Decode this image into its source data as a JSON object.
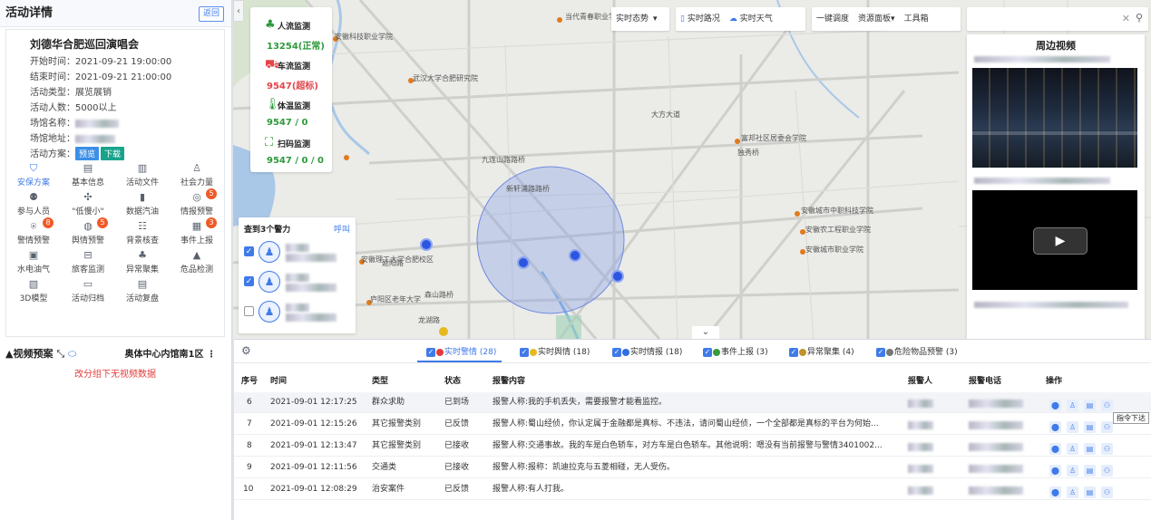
{
  "left_panel": {
    "title": "活动详情",
    "back_label": "返回",
    "event": {
      "name": "刘德华合肥巡回演唱会",
      "fields": [
        {
          "label": "开始时间：",
          "value": "2021-09-21 19:00:00"
        },
        {
          "label": "结束时间：",
          "value": "2021-09-21 21:00:00"
        },
        {
          "label": "活动类型：",
          "value": "展览展销"
        },
        {
          "label": "活动人数：",
          "value": "5000以上"
        },
        {
          "label": "场馆名称：",
          "value": ""
        },
        {
          "label": "场馆地址：",
          "value": ""
        },
        {
          "label": "活动方案：",
          "value": ""
        }
      ],
      "preview_label": "预览",
      "download_label": "下载"
    },
    "grid": [
      {
        "label": "安保方案",
        "icon": "book-icon",
        "badge": ""
      },
      {
        "label": "基本信息",
        "icon": "doc-icon",
        "badge": ""
      },
      {
        "label": "活动文件",
        "icon": "file-icon",
        "badge": ""
      },
      {
        "label": "社会力量",
        "icon": "person-icon",
        "badge": ""
      },
      {
        "label": "参与人员",
        "icon": "people-icon",
        "badge": ""
      },
      {
        "label": "\"低慢小\"",
        "icon": "drone-icon",
        "badge": ""
      },
      {
        "label": "数据汽油",
        "icon": "fuel-icon",
        "badge": ""
      },
      {
        "label": "情报预警",
        "icon": "radar-icon",
        "badge": "5"
      },
      {
        "label": "警情预警",
        "icon": "alarm-icon",
        "badge": "8"
      },
      {
        "label": "舆情预警",
        "icon": "globe-icon",
        "badge": "5"
      },
      {
        "label": "背景核查",
        "icon": "check-icon",
        "badge": ""
      },
      {
        "label": "事件上报",
        "icon": "report-icon",
        "badge": "3"
      },
      {
        "label": "水电油气",
        "icon": "utility-icon",
        "badge": ""
      },
      {
        "label": "旅客监测",
        "icon": "luggage-icon",
        "badge": ""
      },
      {
        "label": "异常聚集",
        "icon": "crowd-icon",
        "badge": ""
      },
      {
        "label": "危品检测",
        "icon": "warning-icon",
        "badge": ""
      },
      {
        "label": "3D模型",
        "icon": "cube-icon",
        "badge": ""
      },
      {
        "label": "活动归档",
        "icon": "archive-icon",
        "badge": ""
      },
      {
        "label": "活动复盘",
        "icon": "replay-icon",
        "badge": ""
      }
    ],
    "video_plan": {
      "title": "视频预案",
      "venue": "奥体中心内馆南1区",
      "empty_msg": "改分组下无视频数据"
    }
  },
  "stats": [
    {
      "label": "人流监测",
      "value": "13254(正常)",
      "color": "#2e9a3c"
    },
    {
      "label": "车流监测",
      "value": "9547(超标)",
      "color": "#e2454a"
    },
    {
      "label": "体温监测",
      "value": "9547 / 0",
      "color": "#2e9a3c"
    },
    {
      "label": "扫码监测",
      "value": "9547 / 0 / 0",
      "color": "#2e9a3c"
    }
  ],
  "police": {
    "title": "查到3个警力",
    "call_label": "呼叫",
    "items": [
      {
        "checked": true
      },
      {
        "checked": true
      },
      {
        "checked": false
      }
    ]
  },
  "toolbar": {
    "realtime": "实时态势",
    "road": "实时路况",
    "weather": "实时天气",
    "dispatch": "一键调度",
    "resource": "资源面板",
    "tools": "工具箱"
  },
  "search": {
    "placeholder": ""
  },
  "nearby_video": {
    "title": "周边视频"
  },
  "map_labels": [
    "当代青春职业学院",
    "安徽科技职业学院",
    "武汉大学合肥研究院",
    "大方大道",
    "富邦社区居委会学院",
    "独秀桥",
    "九连山路路桥",
    "新轩浦路路桥",
    "安徽城市中职科技学院",
    "安徽农工程职业学院",
    "安徽城市职业学院",
    "安徽理工大学合肥校区",
    "森山路桥",
    "龙湖路",
    "延阳路",
    "庐阳区老年大学"
  ],
  "table": {
    "tabs": [
      {
        "label": "实时警情 (28)",
        "color": "#e23b3b",
        "active": true
      },
      {
        "label": "实时舆情 (18)",
        "color": "#e8b820",
        "active": false
      },
      {
        "label": "实时情报 (18)",
        "color": "#2f6fe0",
        "active": false
      },
      {
        "label": "事件上报 (3)",
        "color": "#3a9a3a",
        "active": false
      },
      {
        "label": "异常聚集 (4)",
        "color": "#c2922a",
        "active": false
      },
      {
        "label": "危险物品预警 (3)",
        "color": "#777777",
        "active": false
      }
    ],
    "headers": [
      "序号",
      "时间",
      "类型",
      "状态",
      "报警内容",
      "报警人",
      "报警电话",
      "操作"
    ],
    "rows": [
      {
        "no": "6",
        "time": "2021-09-01 12:17:25",
        "type": "群众求助",
        "status": "已到场",
        "content": "报警人称:我的手机丢失，需要报警才能看监控。"
      },
      {
        "no": "7",
        "time": "2021-09-01 12:15:26",
        "type": "其它报警类别",
        "status": "已反馈",
        "content": "报警人称:蜀山经侦，你认定属于金融都是真标、不违法，请问蜀山经侦，一个全部都是真标的平台为何始..."
      },
      {
        "no": "8",
        "time": "2021-09-01 12:13:47",
        "type": "其它报警类别",
        "status": "已接收",
        "content": "报警人称:交通事故。我的车是白色轿车，对方车是白色轿车。其他说明：嗯没有当前报警与警情3401002..."
      },
      {
        "no": "9",
        "time": "2021-09-01 12:11:56",
        "type": "交通类",
        "status": "已接收",
        "content": "报警人称:报称：凯迪拉克与五菱相碰，无人受伤。"
      },
      {
        "no": "10",
        "time": "2021-09-01 12:08:29",
        "type": "治安案件",
        "status": "已反馈",
        "content": "报警人称:有人打我。"
      }
    ],
    "tooltip": "指令下达"
  }
}
